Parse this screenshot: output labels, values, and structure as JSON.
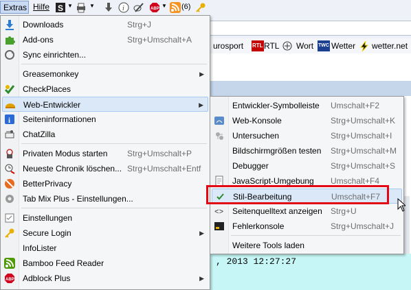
{
  "menubar": {
    "extras": "Extras",
    "hilfe": "Hilfe",
    "rss_count": "(6)"
  },
  "bookmarks": {
    "eurosport": "urosport",
    "rtl_badge": "RTL",
    "rtl": "RTL",
    "wort": "Wort",
    "twc_badge": "TWC",
    "wetter": "Wetter",
    "wetter_net": "wetter.net"
  },
  "timestamp": ", 2013 12:27:27",
  "main_menu": [
    {
      "label": "Downloads",
      "shortcut": "Strg+J",
      "icon": "download-icon"
    },
    {
      "label": "Add-ons",
      "shortcut": "Strg+Umschalt+A",
      "icon": "puzzle-icon"
    },
    {
      "label": "Sync einrichten...",
      "shortcut": "",
      "icon": "sync-icon"
    },
    {
      "label": "Greasemonkey",
      "shortcut": "",
      "icon": "",
      "submenu": true
    },
    {
      "label": "CheckPlaces",
      "shortcut": "",
      "icon": "checkplaces-icon"
    },
    {
      "label": "Web-Entwickler",
      "shortcut": "",
      "icon": "web-developer-icon",
      "submenu": true
    },
    {
      "label": "Seiteninformationen",
      "shortcut": "",
      "icon": "info-icon"
    },
    {
      "label": "ChatZilla",
      "shortcut": "",
      "icon": "chatzilla-icon"
    },
    {
      "label": "Privaten Modus starten",
      "shortcut": "Strg+Umschalt+P",
      "icon": "private-mode-icon"
    },
    {
      "label": "Neueste Chronik löschen...",
      "shortcut": "Strg+Umschalt+Entf",
      "icon": "clear-history-icon"
    },
    {
      "label": "BetterPrivacy",
      "shortcut": "",
      "icon": "betterprivacy-icon"
    },
    {
      "label": "Tab Mix Plus - Einstellungen...",
      "shortcut": "",
      "icon": "tabmix-icon"
    },
    {
      "label": "Einstellungen",
      "shortcut": "",
      "icon": "settings-icon"
    },
    {
      "label": "Secure Login",
      "shortcut": "",
      "icon": "key-icon",
      "submenu": true
    },
    {
      "label": "InfoLister",
      "shortcut": "",
      "icon": ""
    },
    {
      "label": "Bamboo Feed Reader",
      "shortcut": "",
      "icon": "feed-icon"
    },
    {
      "label": "Adblock Plus",
      "shortcut": "",
      "icon": "adblock-icon",
      "submenu": true
    }
  ],
  "sub_menu": [
    {
      "label": "Entwickler-Symbolleiste",
      "shortcut": "Umschalt+F2",
      "icon": ""
    },
    {
      "label": "Web-Konsole",
      "shortcut": "Strg+Umschalt+K",
      "icon": "console-icon"
    },
    {
      "label": "Untersuchen",
      "shortcut": "Strg+Umschalt+I",
      "icon": "inspect-icon"
    },
    {
      "label": "Bildschirmgrößen testen",
      "shortcut": "Strg+Umschalt+M",
      "icon": ""
    },
    {
      "label": "Debugger",
      "shortcut": "Strg+Umschalt+S",
      "icon": ""
    },
    {
      "label": "JavaScript-Umgebung",
      "shortcut": "Umschalt+F4",
      "icon": "scratchpad-icon"
    },
    {
      "label": "Stil-Bearbeitung",
      "shortcut": "Umschalt+F7",
      "icon": "checkmark-icon"
    },
    {
      "label": "Seitenquelltext anzeigen",
      "shortcut": "Strg+U",
      "icon": "source-icon"
    },
    {
      "label": "Fehlerkonsole",
      "shortcut": "Strg+Umschalt+J",
      "icon": "error-console-icon"
    },
    {
      "label": "Weitere Tools laden",
      "shortcut": "",
      "icon": ""
    }
  ],
  "colors": {
    "highlight": "#dbe8f8",
    "red_box": "#e30613",
    "cyan": "#c6f7f6"
  }
}
